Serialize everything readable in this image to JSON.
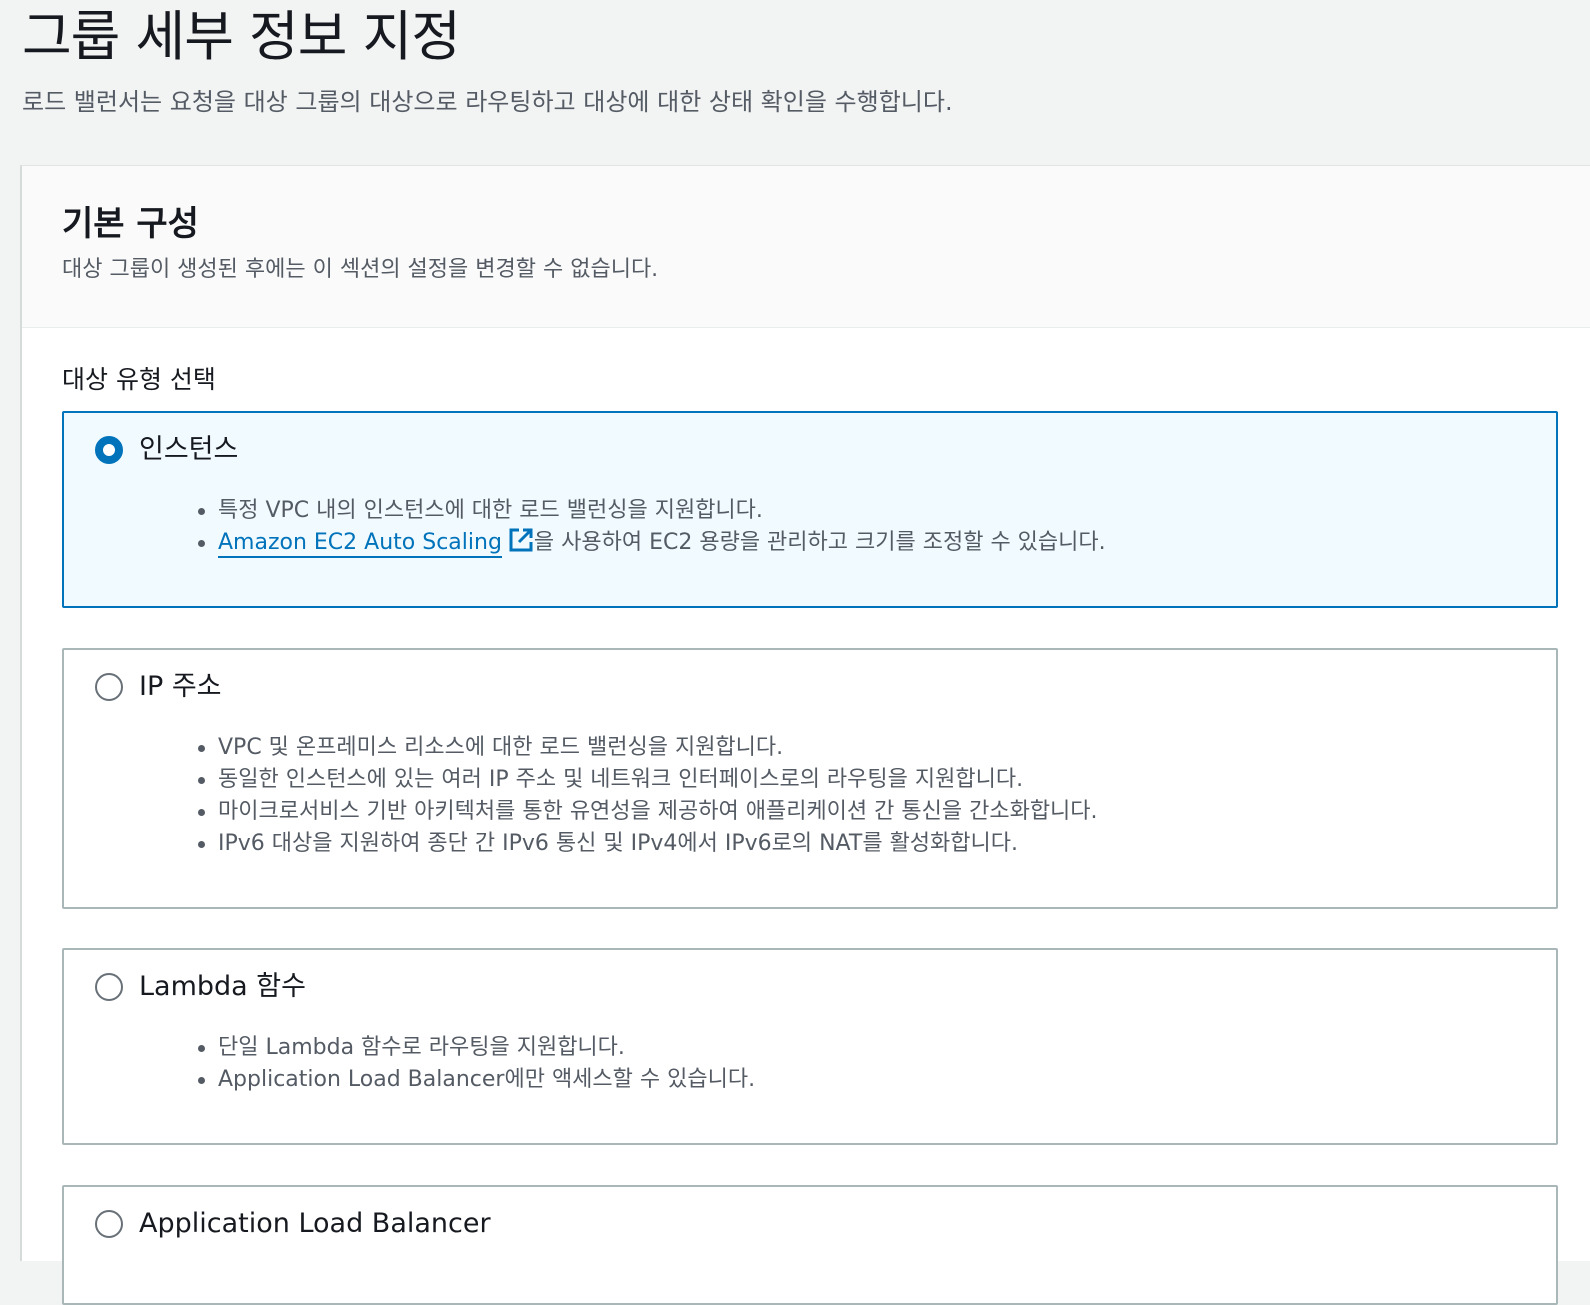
{
  "page": {
    "title": "그룹 세부 정보 지정",
    "description": "로드 밸런서는 요청을 대상 그룹의 대상으로 라우팅하고 대상에 대한 상태 확인을 수행합니다."
  },
  "basic_config": {
    "title": "기본 구성",
    "description": "대상 그룹이 생성된 후에는 이 섹션의 설정을 변경할 수 없습니다.",
    "target_type_label": "대상 유형 선택"
  },
  "options": {
    "instance": {
      "label": "인스턴스",
      "selected": true,
      "bullet1": "특정 VPC 내의 인스턴스에 대한 로드 밸런싱을 지원합니다.",
      "bullet2_link": "Amazon EC2 Auto Scaling",
      "bullet2_icon": "external-link-icon",
      "bullet2_rest": "을 사용하여 EC2 용량을 관리하고 크기를 조정할 수 있습니다."
    },
    "ip": {
      "label": "IP 주소",
      "selected": false,
      "bullets": [
        "VPC 및 온프레미스 리소스에 대한 로드 밸런싱을 지원합니다.",
        "동일한 인스턴스에 있는 여러 IP 주소 및 네트워크 인터페이스로의 라우팅을 지원합니다.",
        "마이크로서비스 기반 아키텍처를 통한 유연성을 제공하여 애플리케이션 간 통신을 간소화합니다.",
        "IPv6 대상을 지원하여 종단 간 IPv6 통신 및 IPv4에서 IPv6로의 NAT를 활성화합니다."
      ]
    },
    "lambda": {
      "label": "Lambda 함수",
      "selected": false,
      "bullets": [
        "단일 Lambda 함수로 라우팅을 지원합니다.",
        "Application Load Balancer에만 액세스할 수 있습니다."
      ]
    },
    "alb": {
      "label": "Application Load Balancer",
      "selected": false
    }
  },
  "colors": {
    "accent": "#0073bb",
    "selected_bg": "#f1faff",
    "page_bg": "#f2f3f3"
  }
}
